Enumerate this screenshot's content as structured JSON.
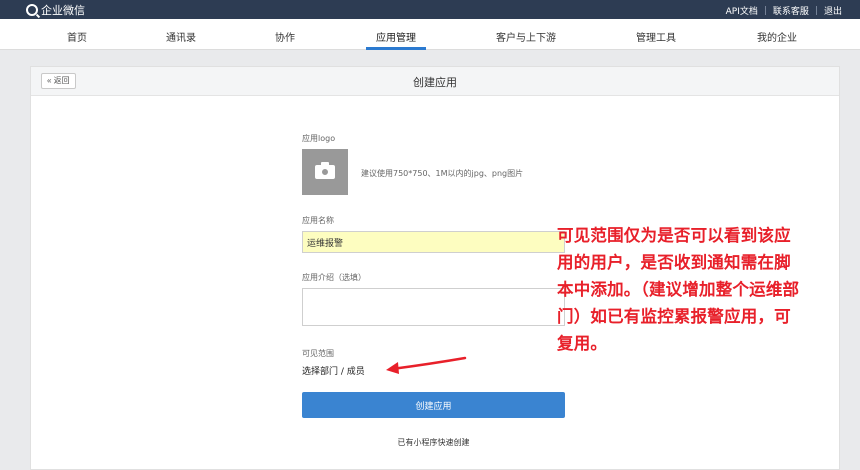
{
  "topbar": {
    "brand": "企业微信",
    "links": [
      "API文档",
      "联系客服",
      "退出"
    ]
  },
  "nav": {
    "items": [
      "首页",
      "通讯录",
      "协作",
      "应用管理",
      "客户与上下游",
      "管理工具",
      "我的企业"
    ],
    "active": "应用管理"
  },
  "page": {
    "back_label": "« 返回",
    "title": "创建应用"
  },
  "form": {
    "logo_label": "应用logo",
    "logo_hint": "建议使用750*750、1M以内的jpg、png图片",
    "name_label": "应用名称",
    "name_value": "运维报警",
    "intro_label": "应用介绍（选填）",
    "intro_value": "",
    "scope_label": "可见范围",
    "scope_link": "选择部门 / 成员",
    "create_button": "创建应用",
    "mini_program_link": "已有小程序快速创建"
  },
  "annotation": {
    "text": "可见范围仅为是否可以看到该应用的用户，是否收到通知需在脚本中添加。（建议增加整个运维部门）如已有监控累报警应用，可复用。",
    "color": "#e8202a"
  },
  "colors": {
    "topbar_bg": "#2d3c53",
    "accent": "#3a84d1",
    "highlight_input": "#fdfdc0"
  }
}
